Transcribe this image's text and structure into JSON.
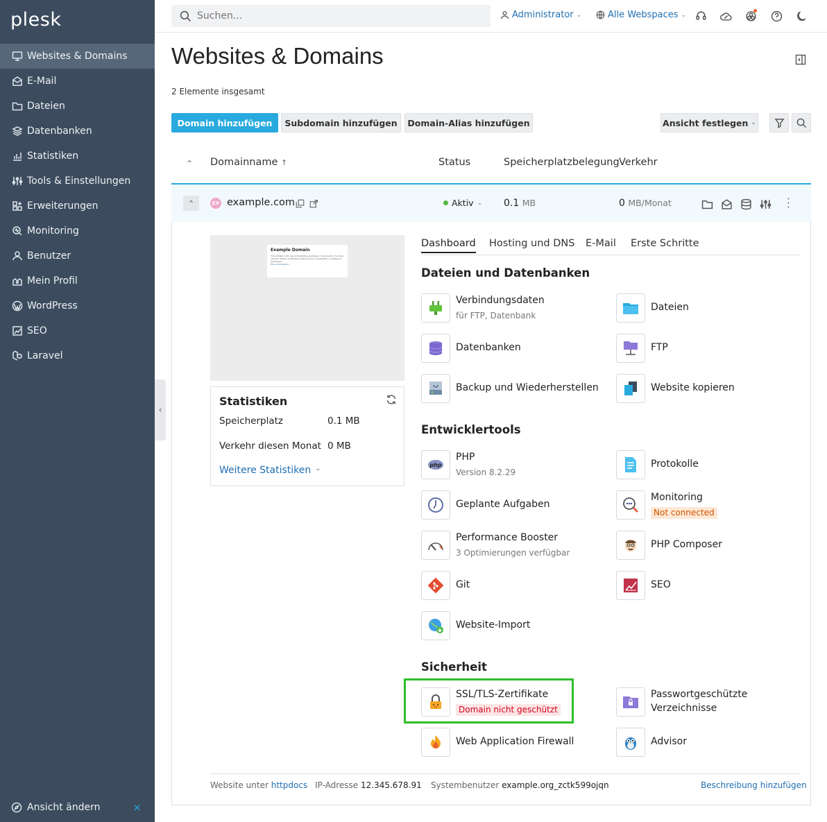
{
  "brand": {
    "logo": "plesk"
  },
  "sidebar": {
    "items": [
      {
        "label": "Websites & Domains",
        "icon": "monitor-icon",
        "active": true
      },
      {
        "label": "E-Mail",
        "icon": "mail-icon"
      },
      {
        "label": "Dateien",
        "icon": "folder-icon"
      },
      {
        "label": "Datenbanken",
        "icon": "database-icon"
      },
      {
        "label": "Statistiken",
        "icon": "chart-icon"
      },
      {
        "label": "Tools & Einstellungen",
        "icon": "sliders-icon"
      },
      {
        "label": "Erweiterungen",
        "icon": "extensions-icon"
      },
      {
        "label": "Monitoring",
        "icon": "monitoring-icon"
      },
      {
        "label": "Benutzer",
        "icon": "user-icon"
      },
      {
        "label": "Mein Profil",
        "icon": "profile-icon"
      },
      {
        "label": "WordPress",
        "icon": "wordpress-icon"
      },
      {
        "label": "SEO",
        "icon": "seo-icon"
      },
      {
        "label": "Laravel",
        "icon": "laravel-icon"
      }
    ],
    "footer_label": "Ansicht ändern",
    "footer_close": "×"
  },
  "header": {
    "search_placeholder": "Suchen...",
    "user": "Administrator",
    "webspaces": "Alle Webspaces"
  },
  "page": {
    "title": "Websites & Domains",
    "total": "2 Elemente insgesamt",
    "buttons": {
      "add_domain": "Domain hinzufügen",
      "add_subdomain": "Subdomain hinzufügen",
      "add_alias": "Domain-Alias hinzufügen",
      "view": "Ansicht festlegen"
    },
    "columns": {
      "domain": "Domainname",
      "status": "Status",
      "storage": "Speicherplatzbelegung",
      "traffic": "Verkehr"
    }
  },
  "domain_row": {
    "name": "example.com",
    "avatar": "EX",
    "status": "Aktiv",
    "storage_value": "0.1",
    "storage_unit": "MB",
    "traffic_value": "0",
    "traffic_unit": "MB/Monat"
  },
  "preview": {
    "heading": "Example Domain",
    "text": "This domain is for use in illustrative examples in documents. You may use this domain in literature without prior coordination or asking for permission.",
    "link": "More information..."
  },
  "stats": {
    "title": "Statistiken",
    "storage_label": "Speicherplatz",
    "storage_value": "0.1 MB",
    "traffic_label": "Verkehr diesen Monat",
    "traffic_value": "0 MB",
    "more": "Weitere Statistiken"
  },
  "tabs": [
    "Dashboard",
    "Hosting und DNS",
    "E-Mail",
    "Erste Schritte"
  ],
  "sections": {
    "files": "Dateien und Datenbanken",
    "dev": "Entwicklertools",
    "security": "Sicherheit"
  },
  "tiles": {
    "connection": {
      "label": "Verbindungsdaten",
      "sub": "für FTP, Datenbank"
    },
    "files": {
      "label": "Dateien"
    },
    "databases": {
      "label": "Datenbanken"
    },
    "ftp": {
      "label": "FTP"
    },
    "backup": {
      "label": "Backup und Wiederherstellen"
    },
    "copy": {
      "label": "Website kopieren"
    },
    "php": {
      "label": "PHP",
      "sub": "Version 8.2.29"
    },
    "logs": {
      "label": "Protokolle"
    },
    "cron": {
      "label": "Geplante Aufgaben"
    },
    "monitoring": {
      "label": "Monitoring",
      "badge": "Not connected"
    },
    "booster": {
      "label": "Performance Booster",
      "sub": "3 Optimierungen verfügbar"
    },
    "composer": {
      "label": "PHP Composer"
    },
    "git": {
      "label": "Git"
    },
    "seo": {
      "label": "SEO"
    },
    "import": {
      "label": "Website-Import"
    },
    "ssl": {
      "label": "SSL/TLS-Zertifikate",
      "badge": "Domain nicht geschützt"
    },
    "protected": {
      "label": "Passwortgeschützte",
      "label2": "Verzeichnisse"
    },
    "waf": {
      "label": "Web Application Firewall"
    },
    "advisor": {
      "label": "Advisor"
    }
  },
  "footer": {
    "website_prefix": "Website unter",
    "website_link": "httpdocs",
    "ip_label": "IP-Adresse",
    "ip_value": "12.345.678.91",
    "sysuser_label": "Systembenutzer",
    "sysuser_value": "example.org_zctk599ojqn",
    "add_description": "Beschreibung hinzufügen"
  },
  "colors": {
    "sidebar": "#3c4b5d",
    "accent": "#28aade",
    "highlight": "#2fbe2a",
    "active_status": "#54b842"
  }
}
